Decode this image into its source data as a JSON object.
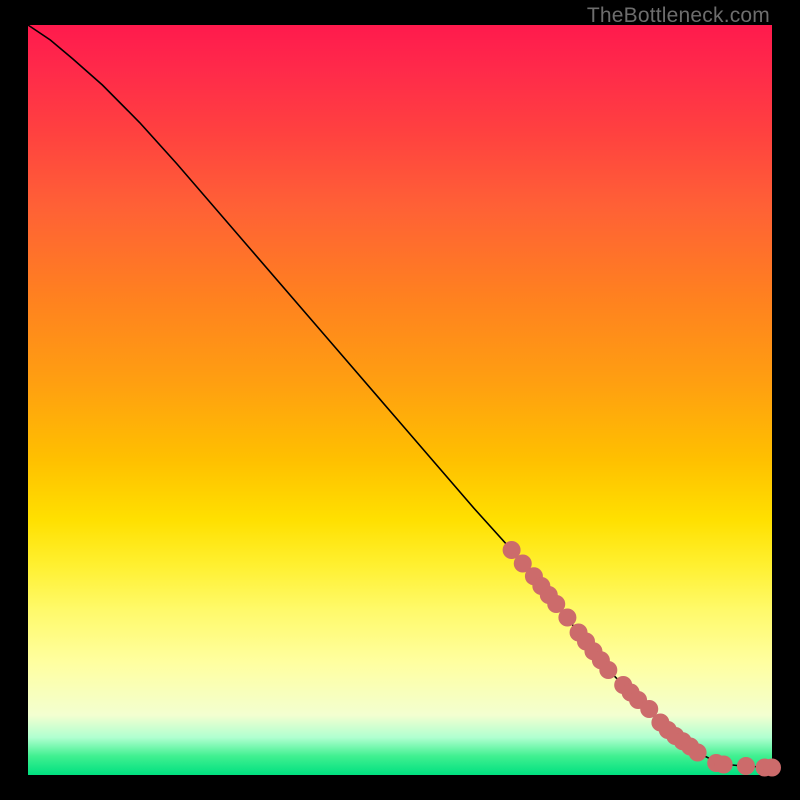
{
  "watermark": "TheBottleneck.com",
  "colors": {
    "frame": "#000000",
    "line": "#000000",
    "dot": "#cc6b6b",
    "gradient_top": "#ff1a4d",
    "gradient_bottom": "#00e080"
  },
  "chart_data": {
    "type": "line",
    "title": "",
    "xlabel": "",
    "ylabel": "",
    "xlim": [
      0,
      100
    ],
    "ylim": [
      0,
      100
    ],
    "series": [
      {
        "name": "bottleneck-curve",
        "x": [
          0,
          3,
          6,
          10,
          15,
          20,
          30,
          40,
          50,
          60,
          65,
          68,
          70,
          72,
          74,
          76,
          78,
          80,
          82,
          84,
          86,
          88,
          90,
          92,
          94,
          96,
          98,
          100
        ],
        "y": [
          100,
          98,
          95.5,
          92,
          87,
          81.5,
          70,
          58.5,
          47,
          35.5,
          30,
          26.5,
          24,
          21.5,
          19,
          16.5,
          14,
          12,
          10,
          8,
          6,
          4.5,
          3,
          2,
          1.4,
          1.2,
          1.1,
          1.0
        ]
      }
    ],
    "highlighted_points": {
      "name": "dots",
      "points": [
        {
          "x": 65.0,
          "y": 30.0
        },
        {
          "x": 66.5,
          "y": 28.2
        },
        {
          "x": 68.0,
          "y": 26.5
        },
        {
          "x": 69.0,
          "y": 25.2
        },
        {
          "x": 70.0,
          "y": 24.0
        },
        {
          "x": 71.0,
          "y": 22.8
        },
        {
          "x": 72.5,
          "y": 21.0
        },
        {
          "x": 74.0,
          "y": 19.0
        },
        {
          "x": 75.0,
          "y": 17.8
        },
        {
          "x": 76.0,
          "y": 16.5
        },
        {
          "x": 77.0,
          "y": 15.3
        },
        {
          "x": 78.0,
          "y": 14.0
        },
        {
          "x": 80.0,
          "y": 12.0
        },
        {
          "x": 81.0,
          "y": 11.0
        },
        {
          "x": 82.0,
          "y": 10.0
        },
        {
          "x": 83.5,
          "y": 8.8
        },
        {
          "x": 85.0,
          "y": 7.0
        },
        {
          "x": 86.0,
          "y": 6.0
        },
        {
          "x": 87.0,
          "y": 5.2
        },
        {
          "x": 88.0,
          "y": 4.5
        },
        {
          "x": 89.0,
          "y": 3.8
        },
        {
          "x": 90.0,
          "y": 3.0
        },
        {
          "x": 92.5,
          "y": 1.6
        },
        {
          "x": 93.5,
          "y": 1.4
        },
        {
          "x": 96.5,
          "y": 1.2
        },
        {
          "x": 99.0,
          "y": 1.0
        },
        {
          "x": 100.0,
          "y": 1.0
        }
      ]
    }
  }
}
